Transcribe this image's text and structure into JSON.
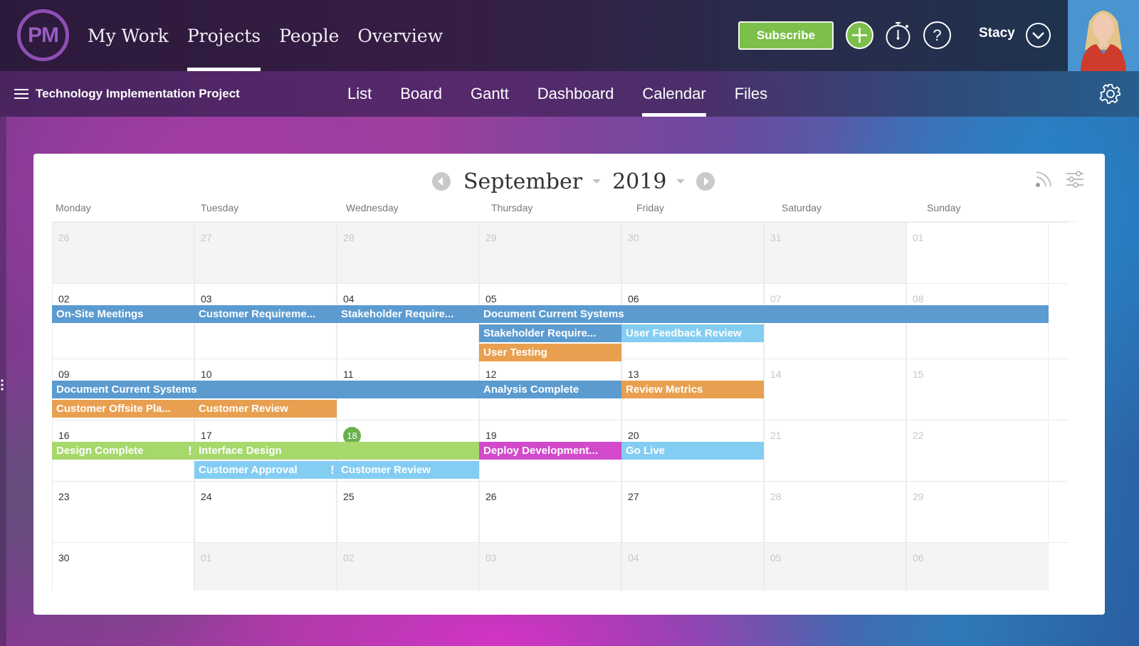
{
  "app": {
    "logo_text": "PM",
    "main_nav": [
      {
        "label": "My Work",
        "active": false
      },
      {
        "label": "Projects",
        "active": true
      },
      {
        "label": "People",
        "active": false
      },
      {
        "label": "Overview",
        "active": false
      }
    ],
    "subscribe_label": "Subscribe",
    "user_name": "Stacy",
    "icons": {
      "add": "plus-circle-icon",
      "timer": "stopwatch-icon",
      "help": "question-circle-icon",
      "user_menu": "chevron-down-circle-icon",
      "settings": "gear-icon",
      "feed": "rss-icon",
      "filters": "sliders-icon"
    }
  },
  "project": {
    "title": "Technology Implementation Project",
    "tabs": [
      {
        "label": "List",
        "active": false
      },
      {
        "label": "Board",
        "active": false
      },
      {
        "label": "Gantt",
        "active": false
      },
      {
        "label": "Dashboard",
        "active": false
      },
      {
        "label": "Calendar",
        "active": true
      },
      {
        "label": "Files",
        "active": false
      }
    ]
  },
  "calendar": {
    "month": "September",
    "year": "2019",
    "today": "18",
    "weekdays": [
      "Monday",
      "Tuesday",
      "Wednesday",
      "Thursday",
      "Friday",
      "Saturday",
      "Sunday"
    ],
    "weeks": [
      {
        "days": [
          {
            "num": "26",
            "other": true
          },
          {
            "num": "27",
            "other": true
          },
          {
            "num": "28",
            "other": true
          },
          {
            "num": "29",
            "other": true
          },
          {
            "num": "30",
            "other": true
          },
          {
            "num": "31",
            "other": true
          },
          {
            "num": "01",
            "other": false,
            "weekend": true
          }
        ]
      },
      {
        "days": [
          {
            "num": "02"
          },
          {
            "num": "03"
          },
          {
            "num": "04"
          },
          {
            "num": "05"
          },
          {
            "num": "06"
          },
          {
            "num": "07",
            "weekend": true
          },
          {
            "num": "08",
            "weekend": true
          }
        ]
      },
      {
        "days": [
          {
            "num": "09"
          },
          {
            "num": "10"
          },
          {
            "num": "11"
          },
          {
            "num": "12"
          },
          {
            "num": "13"
          },
          {
            "num": "14",
            "weekend": true
          },
          {
            "num": "15",
            "weekend": true
          }
        ]
      },
      {
        "days": [
          {
            "num": "16"
          },
          {
            "num": "17"
          },
          {
            "num": "18",
            "today": true
          },
          {
            "num": "19"
          },
          {
            "num": "20"
          },
          {
            "num": "21",
            "weekend": true
          },
          {
            "num": "22",
            "weekend": true
          }
        ]
      },
      {
        "days": [
          {
            "num": "23"
          },
          {
            "num": "24"
          },
          {
            "num": "25"
          },
          {
            "num": "26"
          },
          {
            "num": "27"
          },
          {
            "num": "28",
            "weekend": true
          },
          {
            "num": "29",
            "weekend": true
          }
        ]
      },
      {
        "days": [
          {
            "num": "30"
          },
          {
            "num": "01",
            "other": true
          },
          {
            "num": "02",
            "other": true
          },
          {
            "num": "03",
            "other": true
          },
          {
            "num": "04",
            "other": true
          },
          {
            "num": "05",
            "other": true
          },
          {
            "num": "06",
            "other": true
          }
        ]
      }
    ],
    "colors": {
      "blue": "#5b9bd0",
      "light_blue": "#84cdf2",
      "orange": "#e8a050",
      "green": "#a6d86c",
      "magenta": "#d249cc",
      "today": "#6ab04c",
      "subscribe": "#7cbf4a"
    },
    "events": [
      {
        "title": "On-Site Meetings",
        "week": 1,
        "start": 0,
        "span": 1,
        "lane": 0,
        "color": "blue"
      },
      {
        "title": "Customer Requireme...",
        "week": 1,
        "start": 1,
        "span": 1,
        "lane": 0,
        "color": "blue"
      },
      {
        "title": "Stakeholder Require...",
        "week": 1,
        "start": 2,
        "span": 1,
        "lane": 0,
        "color": "blue"
      },
      {
        "title": "Document Current Systems",
        "week": 1,
        "start": 3,
        "span": 4,
        "lane": 0,
        "color": "blue"
      },
      {
        "title": "Stakeholder Require...",
        "week": 1,
        "start": 3,
        "span": 1,
        "lane": 1,
        "color": "blue"
      },
      {
        "title": "User Feedback Review",
        "week": 1,
        "start": 4,
        "span": 1,
        "lane": 1,
        "color": "light_blue"
      },
      {
        "title": "User Testing",
        "week": 1,
        "start": 3,
        "span": 1,
        "lane": 2,
        "color": "orange"
      },
      {
        "title": "Document Current Systems",
        "week": 2,
        "start": 0,
        "span": 3,
        "lane": 0,
        "color": "blue"
      },
      {
        "title": "Analysis Complete",
        "week": 2,
        "start": 3,
        "span": 1,
        "lane": 0,
        "color": "blue"
      },
      {
        "title": "Review Metrics",
        "week": 2,
        "start": 4,
        "span": 1,
        "lane": 0,
        "color": "orange"
      },
      {
        "title": "Customer Offsite Pla...",
        "week": 2,
        "start": 0,
        "span": 1,
        "lane": 1,
        "color": "orange"
      },
      {
        "title": "Customer Review",
        "week": 2,
        "start": 1,
        "span": 1,
        "lane": 1,
        "color": "orange"
      },
      {
        "title": "Design Complete",
        "week": 3,
        "start": 0,
        "span": 1,
        "lane": 0,
        "color": "green"
      },
      {
        "title": "Interface Design",
        "week": 3,
        "start": 1,
        "span": 2,
        "lane": 0,
        "color": "green",
        "flag": true
      },
      {
        "title": "Deploy Development...",
        "week": 3,
        "start": 3,
        "span": 1,
        "lane": 0,
        "color": "magenta"
      },
      {
        "title": "Go Live",
        "week": 3,
        "start": 4,
        "span": 1,
        "lane": 0,
        "color": "light_blue"
      },
      {
        "title": "Customer Approval",
        "week": 3,
        "start": 1,
        "span": 1,
        "lane": 1,
        "color": "light_blue"
      },
      {
        "title": "Customer Review",
        "week": 3,
        "start": 2,
        "span": 1,
        "lane": 1,
        "color": "light_blue",
        "flag": true
      }
    ]
  }
}
